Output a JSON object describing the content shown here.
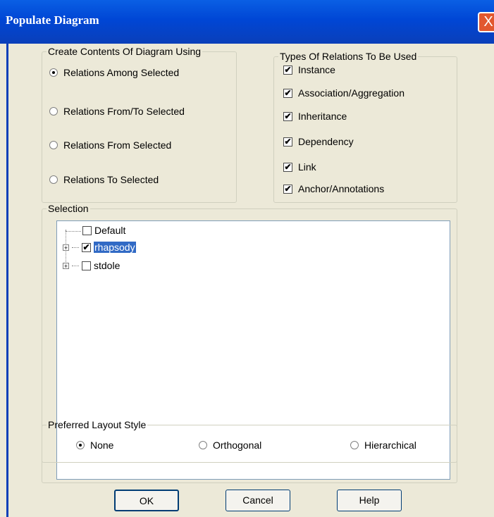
{
  "window": {
    "title": "Populate Diagram",
    "close_glyph": "X"
  },
  "create_contents": {
    "legend": "Create Contents Of Diagram Using",
    "options": [
      {
        "label": "Relations Among Selected",
        "selected": true
      },
      {
        "label": "Relations From/To Selected",
        "selected": false
      },
      {
        "label": "Relations From Selected",
        "selected": false
      },
      {
        "label": "Relations To Selected",
        "selected": false
      }
    ]
  },
  "relation_types": {
    "legend": "Types Of Relations To Be Used",
    "items": [
      {
        "label": "Instance",
        "checked": true
      },
      {
        "label": "Association/Aggregation",
        "checked": true
      },
      {
        "label": "Inheritance",
        "checked": true
      },
      {
        "label": "Dependency",
        "checked": true
      },
      {
        "label": "Link",
        "checked": true
      },
      {
        "label": "Anchor/Annotations",
        "checked": true
      }
    ]
  },
  "selection": {
    "legend": "Selection",
    "tree": [
      {
        "label": "Default",
        "checked": false,
        "expandable": false
      },
      {
        "label": "rhapsody",
        "checked": true,
        "expandable": true,
        "selected": true
      },
      {
        "label": "stdole",
        "checked": false,
        "expandable": true
      }
    ],
    "expander_glyph": "+"
  },
  "layout_style": {
    "legend": "Preferred Layout Style",
    "options": [
      {
        "label": "None",
        "selected": true
      },
      {
        "label": "Orthogonal",
        "selected": false
      },
      {
        "label": "Hierarchical",
        "selected": false
      }
    ]
  },
  "buttons": {
    "ok": "OK",
    "cancel": "Cancel",
    "help": "Help"
  },
  "check_glyph": "✔"
}
